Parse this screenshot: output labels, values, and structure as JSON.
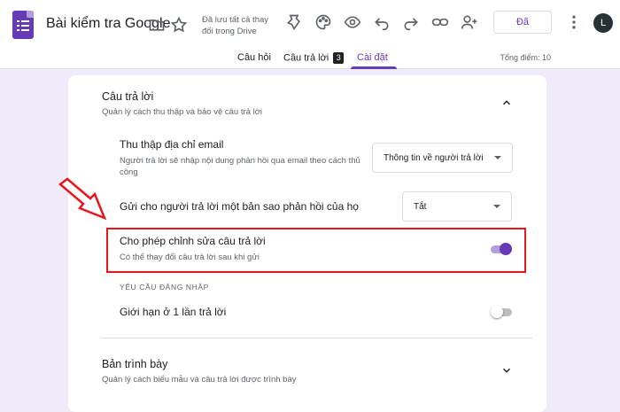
{
  "header": {
    "doc_title": "Bài kiểm tra Google",
    "save_status": "Đã lưu tất cả thay đổi trong Drive",
    "send_label": "Đã",
    "avatar_letter": "L",
    "icons": [
      "folder-icon",
      "star-icon",
      "customize-theme-icon",
      "palette-icon",
      "preview-eye-icon",
      "undo-icon",
      "redo-icon",
      "link-icon",
      "add-collaborator-icon",
      "more-vert-icon"
    ]
  },
  "tabs": {
    "questions": "Câu hỏi",
    "responses": "Câu trả lời",
    "responses_count": "3",
    "settings": "Cài đặt",
    "total_points": "Tổng điểm: 10"
  },
  "responses_section": {
    "title": "Câu trả lời",
    "subtitle": "Quản lý cách thu thập và bảo vệ câu trả lời",
    "collect_email": {
      "title": "Thu thập địa chỉ email",
      "subtitle": "Người trả lời sẽ nhập nội dung phản hồi qua email theo cách thủ công",
      "selected": "Thông tin về người trả lời"
    },
    "send_copy": {
      "title": "Gửi cho người trả lời một bản sao phản hồi của họ",
      "selected": "Tắt"
    },
    "allow_edit": {
      "title": "Cho phép chỉnh sửa câu trả lời",
      "subtitle": "Có thể thay đổi câu trả lời sau khi gửi",
      "enabled": true
    },
    "login_label": "YÊU CẦU ĐĂNG NHẬP",
    "limit_one": {
      "title": "Giới hạn ở 1 lần trả lời",
      "enabled": false
    }
  },
  "presentation_section": {
    "title": "Bản trình bày",
    "subtitle": "Quản lý cách biểu mẫu và câu trả lời được trình bày"
  },
  "colors": {
    "accent": "#673ab7",
    "highlight": "#e8141e",
    "background": "#f0ebf8"
  }
}
